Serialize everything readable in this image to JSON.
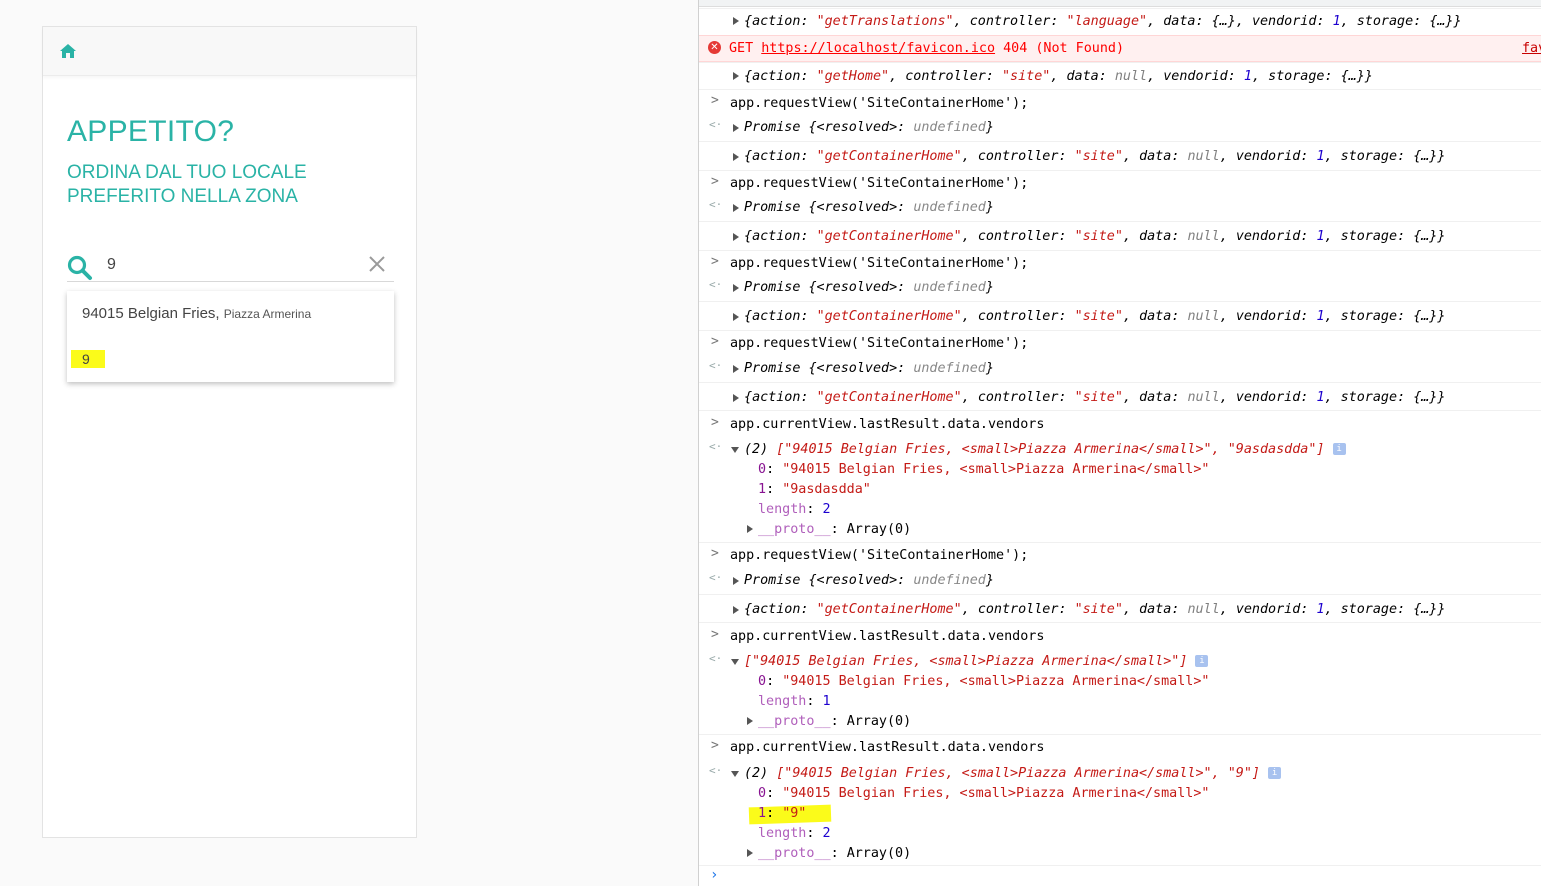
{
  "app": {
    "title": "APPETITO?",
    "subtitle": "ORDINA DAL TUO LOCALE PREFERITO NELLA ZONA",
    "search": {
      "value": "9"
    },
    "suggestions": [
      {
        "name": "94015 Belgian Fries,",
        "place": "Piazza Armerina"
      },
      {
        "name": "9"
      }
    ],
    "icons": {
      "home": "home-icon",
      "search": "search-icon",
      "clear": "close-icon"
    },
    "colors": {
      "accent": "#2ab3a6",
      "highlight": "#fbfb1a"
    }
  },
  "console": {
    "error": {
      "method": "GET",
      "url": "https://localhost/favicon.ico",
      "status": "404 (Not Found)",
      "source": "fav"
    },
    "obj_translations": {
      "action": "\"getTranslations\"",
      "controller": "\"language\"",
      "data": "{…}",
      "vendorid": "1",
      "storage": "{…}}"
    },
    "obj_home": {
      "action": "\"getHome\"",
      "controller": "\"site\"",
      "data": "null",
      "vendorid": "1",
      "storage": "{…}}"
    },
    "obj_container": {
      "action": "\"getContainerHome\"",
      "controller": "\"site\"",
      "data": "null",
      "vendorid": "1",
      "storage": "{…}}"
    },
    "cmd_request": "app.requestView('SiteContainerHome');",
    "promise": {
      "label": "Promise",
      "resolved": "{<resolved>: ",
      "undef": "undefined",
      "close": "}"
    },
    "cmd_vendors": "app.currentView.lastResult.data.vendors",
    "array1": {
      "summary_count": "(2)",
      "summary_items": "[\"94015 Belgian Fries, <small>Piazza Armerina</small>\", \"9asdasdda\"]",
      "item0": "\"94015 Belgian Fries, <small>Piazza Armerina</small>\"",
      "item1": "\"9asdasdda\"",
      "length": "2"
    },
    "array2": {
      "summary_items": "[\"94015 Belgian Fries, <small>Piazza Armerina</small>\"]",
      "item0": "\"94015 Belgian Fries, <small>Piazza Armerina</small>\"",
      "length": "1"
    },
    "array3": {
      "summary_count": "(2)",
      "summary_items": "[\"94015 Belgian Fries, <small>Piazza Armerina</small>\", \"9\"]",
      "item0": "\"94015 Belgian Fries, <small>Piazza Armerina</small>\"",
      "item1": "\"9\"",
      "length": "2"
    },
    "proto": "Array(0)",
    "keys": {
      "action": "action",
      "controller": "controller",
      "data": "data",
      "vendorid": "vendorid",
      "storage": "storage",
      "length": "length",
      "proto": "__proto__",
      "idx0": "0",
      "idx1": "1"
    }
  }
}
